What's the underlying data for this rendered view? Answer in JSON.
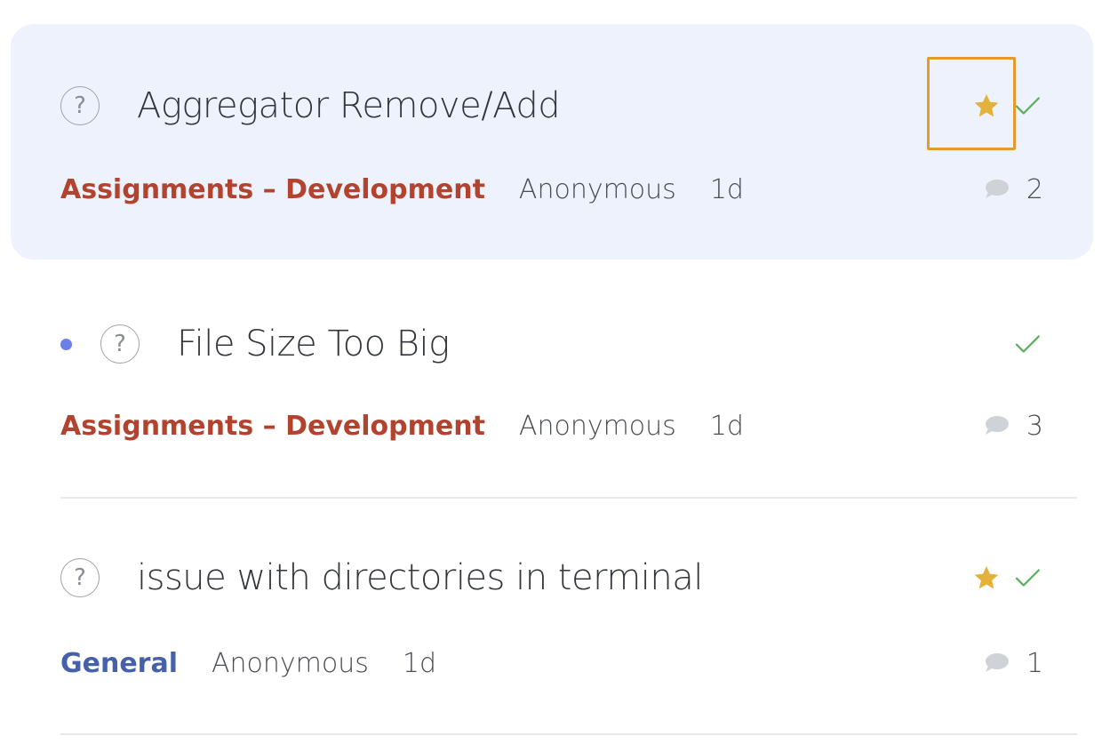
{
  "threads": [
    {
      "title": "Aggregator Remove/Add",
      "category": "Assignments – Development",
      "category_color": "#b2432e",
      "author": "Anonymous",
      "age": "1d",
      "comments": "2",
      "question_mark": "?",
      "starred": true,
      "answered": true,
      "unread": false,
      "selected": true
    },
    {
      "title": "File Size Too Big",
      "category": "Assignments – Development",
      "category_color": "#b2432e",
      "author": "Anonymous",
      "age": "1d",
      "comments": "3",
      "question_mark": "?",
      "starred": false,
      "answered": true,
      "unread": true,
      "selected": false
    },
    {
      "title": "issue with directories in terminal",
      "category": "General",
      "category_color": "#4661a8",
      "author": "Anonymous",
      "age": "1d",
      "comments": "1",
      "question_mark": "?",
      "starred": true,
      "answered": true,
      "unread": false,
      "selected": false
    }
  ],
  "colors": {
    "star": "#e4b23a",
    "check": "#5aae5e",
    "unread_dot": "#6a7fe8",
    "selected_bg": "#eef2fc",
    "highlight": "#e59b2c",
    "comment_icon": "#cfd2d6"
  },
  "icons": {
    "question": "question-circle-icon",
    "star": "star-icon",
    "check": "check-icon",
    "comment": "comment-bubble-icon",
    "unread": "unread-dot-icon"
  }
}
